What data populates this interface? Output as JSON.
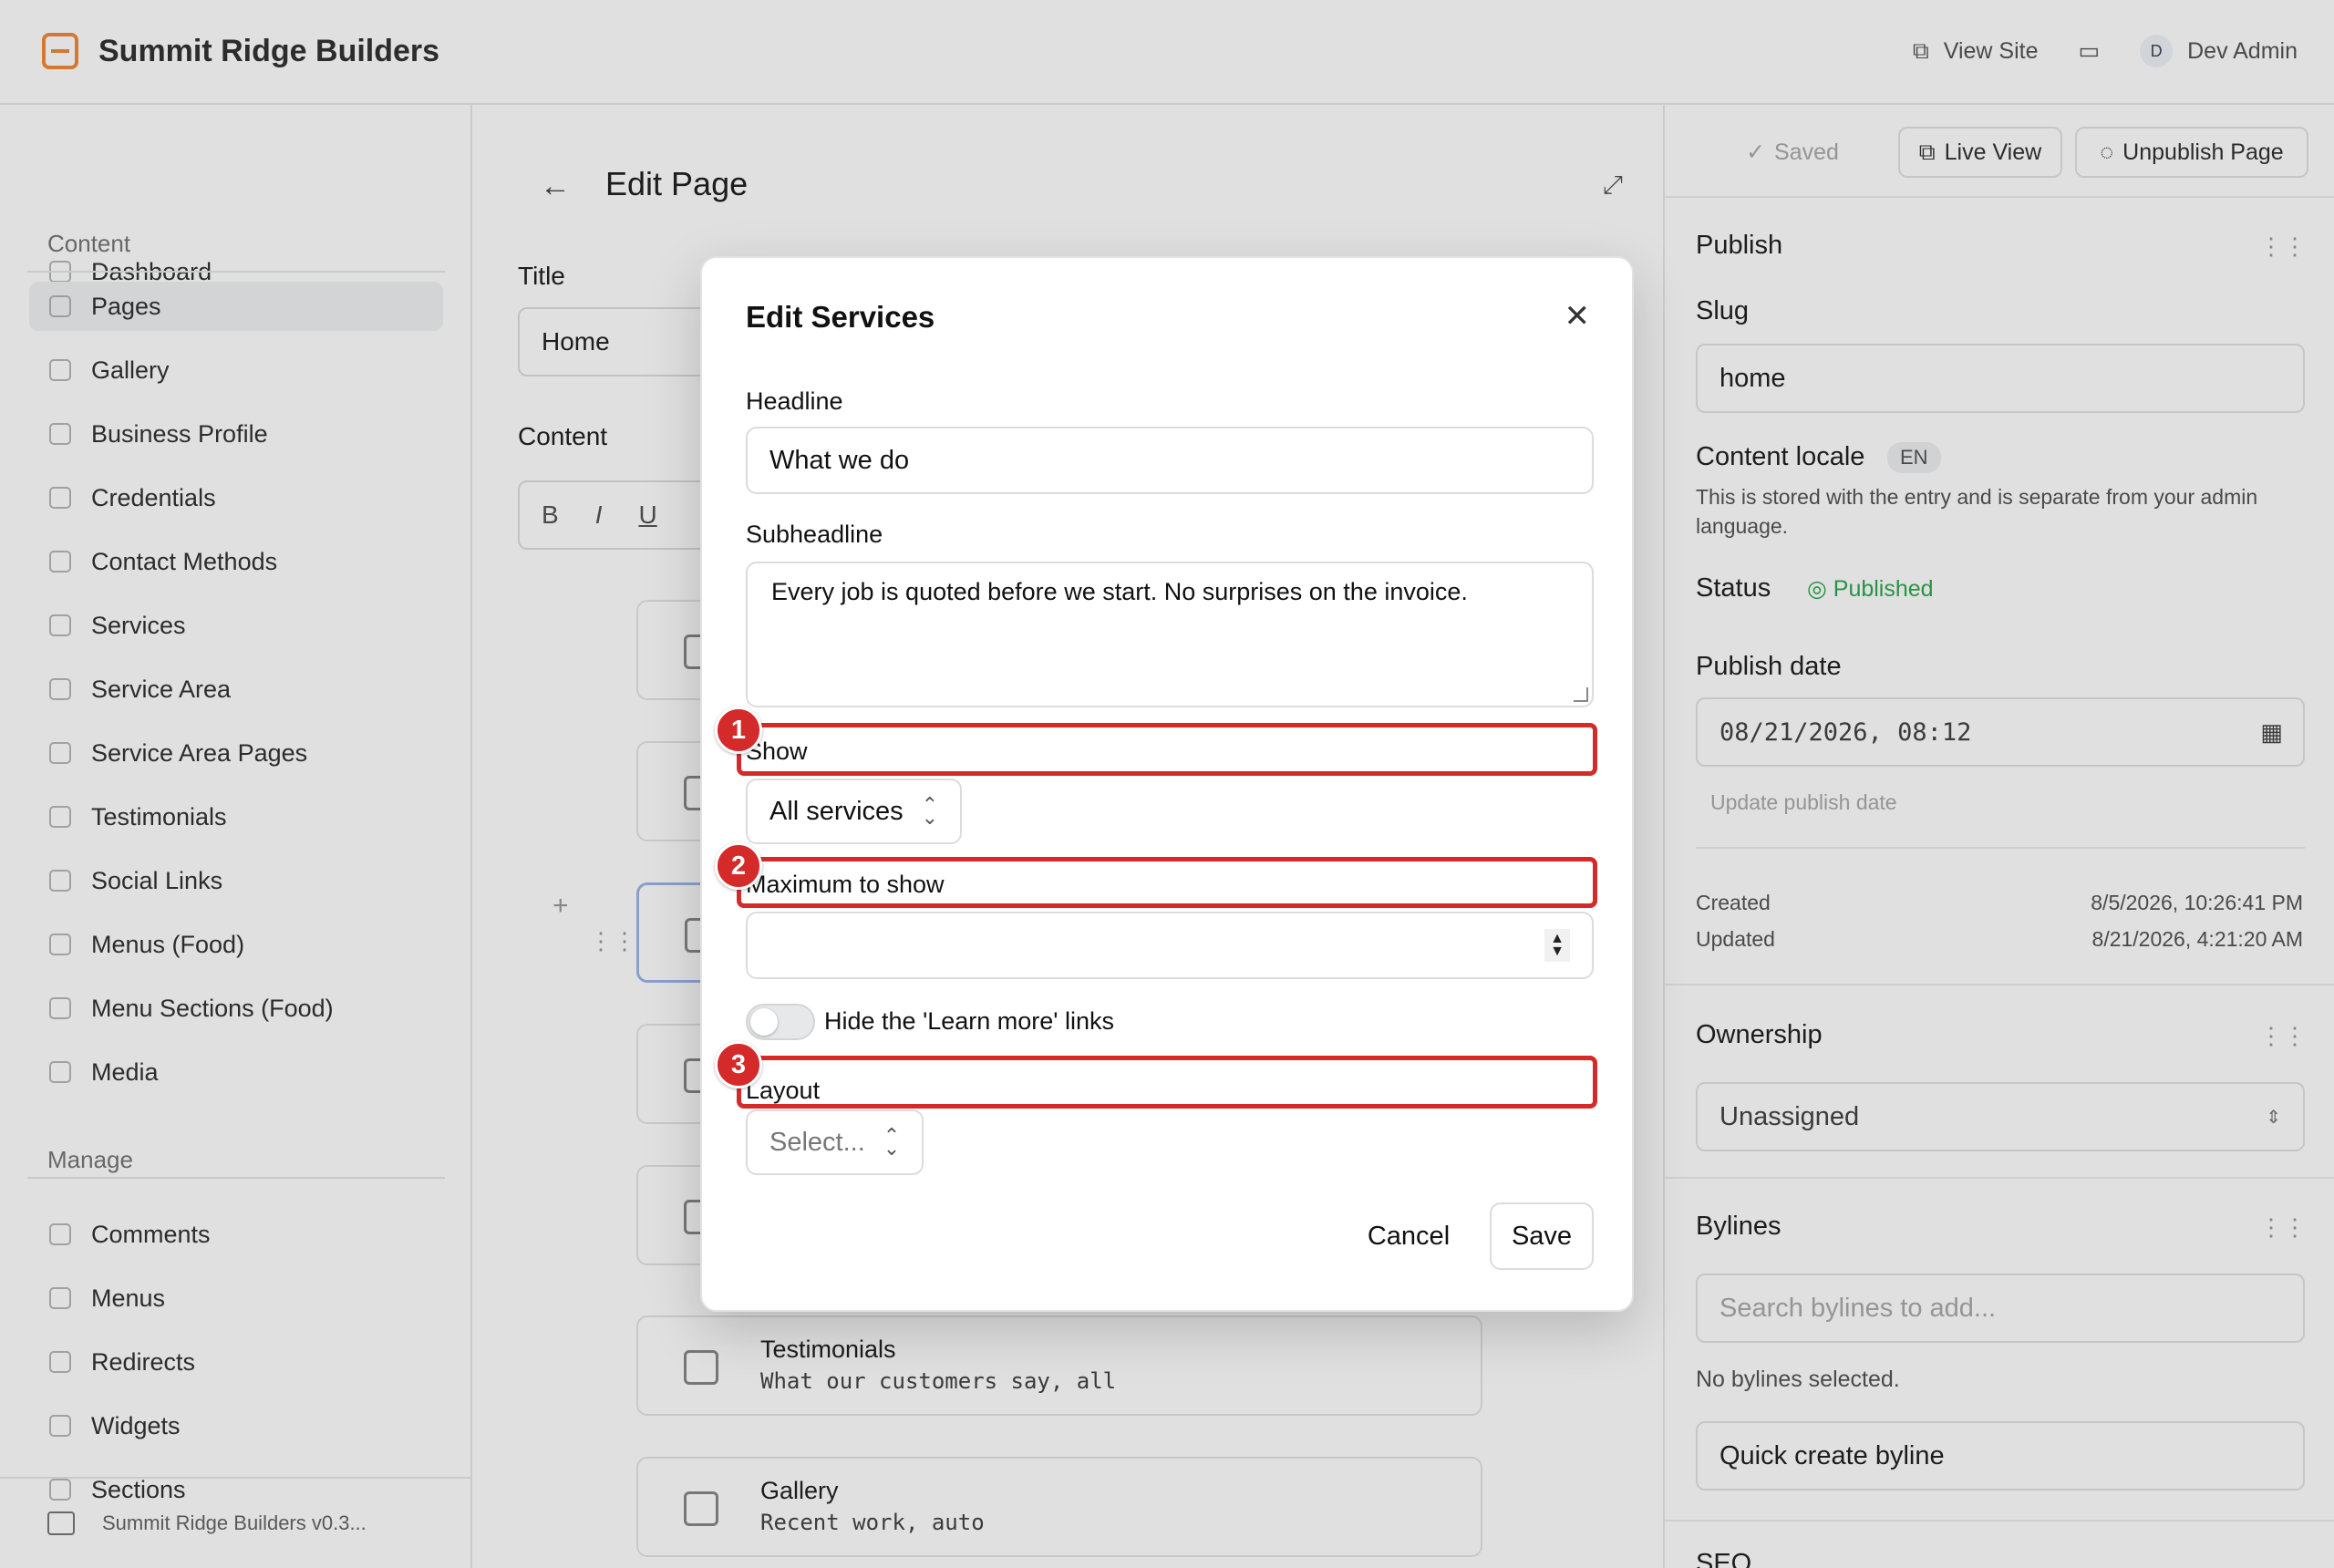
{
  "app": {
    "brand": "Summit Ridge Builders",
    "topnav": {
      "view_site": "View Site",
      "user_initial": "D",
      "user_name": "Dev Admin"
    }
  },
  "sidebar": {
    "items_top": [
      {
        "label": "Dashboard",
        "icon": "grid-icon"
      }
    ],
    "content_section": "Content",
    "content_items": [
      {
        "label": "Pages",
        "active": true
      },
      {
        "label": "Gallery"
      },
      {
        "label": "Business Profile"
      },
      {
        "label": "Credentials"
      },
      {
        "label": "Contact Methods"
      },
      {
        "label": "Services"
      },
      {
        "label": "Service Area"
      },
      {
        "label": "Service Area Pages"
      },
      {
        "label": "Testimonials"
      },
      {
        "label": "Social Links"
      },
      {
        "label": "Menus (Food)"
      },
      {
        "label": "Menu Sections (Food)"
      },
      {
        "label": "Media"
      }
    ],
    "manage_section": "Manage",
    "manage_items": [
      {
        "label": "Comments"
      },
      {
        "label": "Menus"
      },
      {
        "label": "Redirects"
      },
      {
        "label": "Widgets"
      },
      {
        "label": "Sections"
      }
    ],
    "footer": "Summit Ridge Builders v0.3..."
  },
  "main": {
    "heading": "Edit Page",
    "title_label": "Title",
    "title_value": "Home",
    "content_label": "Content",
    "toolbar": [
      "B",
      "I",
      "U"
    ],
    "blocks": [
      {
        "title": "Testimonials",
        "desc": "What our customers say, all"
      },
      {
        "title": "Gallery",
        "desc": "Recent work, auto"
      }
    ]
  },
  "right_panel": {
    "saved": "Saved",
    "live_view": "Live View",
    "unpublish": "Unpublish Page",
    "publish_heading": "Publish",
    "slug_label": "Slug",
    "slug_value": "home",
    "locale_label": "Content locale",
    "locale_badge": "EN",
    "locale_note": "This is stored with the entry and is separate from your admin language.",
    "status_label": "Status",
    "status_value": "Published",
    "publish_date_label": "Publish date",
    "publish_date_value": "08/21/2026, 08:12",
    "update_publish_date": "Update publish date",
    "created_label": "Created",
    "created_value": "8/5/2026, 10:26:41 PM",
    "updated_label": "Updated",
    "updated_value": "8/21/2026, 4:21:20 AM",
    "ownership_heading": "Ownership",
    "ownership_value": "Unassigned",
    "bylines_heading": "Bylines",
    "bylines_placeholder": "Search bylines to add...",
    "bylines_empty": "No bylines selected.",
    "quick_create": "Quick create byline",
    "seo_heading": "SEO"
  },
  "modal": {
    "title": "Edit Services",
    "headline_label": "Headline",
    "headline_value": "What we do",
    "subheadline_label": "Subheadline",
    "subheadline_value": "Every job is quoted before we start. No surprises on the invoice.",
    "show_label": "Show",
    "show_value": "All services",
    "max_label": "Maximum to show",
    "max_value": "",
    "hide_learn_more": "Hide the 'Learn more' links",
    "layout_label": "Layout",
    "layout_placeholder": "Select...",
    "cancel": "Cancel",
    "save": "Save"
  },
  "annotations": [
    "1",
    "2",
    "3"
  ],
  "colors": {
    "annotation": "#d42a2a",
    "status_green": "#2fa84f",
    "brand_orange": "#f08a3c"
  }
}
